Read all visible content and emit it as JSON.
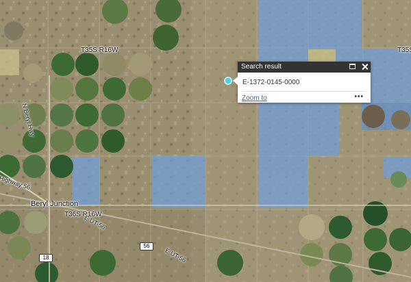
{
  "popup": {
    "title": "Search result",
    "value": "E-1372-0145-0000",
    "zoom_label": "Zoom to",
    "more_label": "•••"
  },
  "map_labels": {
    "township_north_1": "T35S R16W",
    "township_north_2": "T35S",
    "township_south": "T36S R16W",
    "town": "Beryl Junction",
    "road_n_beryl": "N Beryl Hwy",
    "road_highway56": "Highway 56",
    "road_e_ut56_a": "E UT-56",
    "road_e_ut56_b": "E UT-56",
    "shield_56": "56",
    "shield_18": "18"
  },
  "colors": {
    "parcel_highlight": "#6f9fdc",
    "selected_marker": "#4fd0d8",
    "popup_header": "#333333"
  }
}
